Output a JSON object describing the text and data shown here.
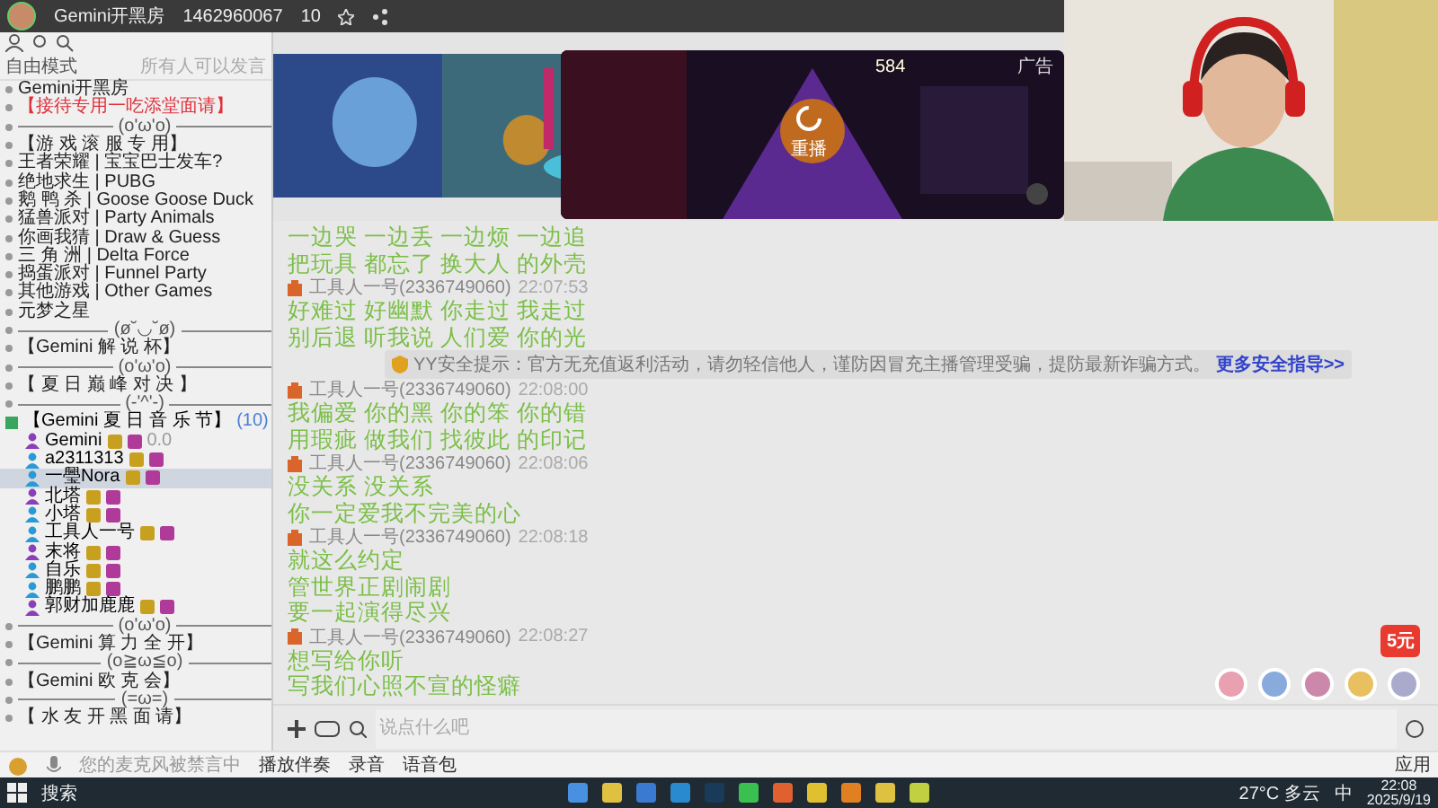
{
  "title_bar": {
    "room_name": "Gemini开黑房",
    "room_id": "1462960067",
    "online": "10"
  },
  "sidebar": {
    "mode": "自由模式",
    "permission": "所有人可以发言",
    "items": [
      {
        "kind": "channel",
        "label": "Gemini开黑房"
      },
      {
        "kind": "channel",
        "label": "【接待专用一吃添堂面请】",
        "color": "#e0303a"
      },
      {
        "kind": "divider",
        "label": "(o'ω'o)"
      },
      {
        "kind": "channel",
        "label": "【游 戏 滚 服 专 用】"
      },
      {
        "kind": "channel",
        "label": "王者荣耀 | 宝宝巴士发车?"
      },
      {
        "kind": "channel",
        "label": "绝地求生 | PUBG"
      },
      {
        "kind": "channel",
        "label": "鹅 鸭 杀 | Goose Goose Duck"
      },
      {
        "kind": "channel",
        "label": "猛兽派对 | Party Animals"
      },
      {
        "kind": "channel",
        "label": "你画我猜 | Draw & Guess"
      },
      {
        "kind": "channel",
        "label": "三 角 洲 | Delta Force"
      },
      {
        "kind": "channel",
        "label": "捣蛋派对 | Funnel Party"
      },
      {
        "kind": "channel",
        "label": "其他游戏 | Other Games"
      },
      {
        "kind": "channel",
        "label": "元梦之星"
      },
      {
        "kind": "divider",
        "label": "(ø˘◡˘ø)"
      },
      {
        "kind": "channel",
        "label": "【Gemini 解 说 杯】"
      },
      {
        "kind": "divider",
        "label": "(o'ω'o)"
      },
      {
        "kind": "channel",
        "label": "【 夏 日 巅 峰 对 决 】"
      },
      {
        "kind": "divider",
        "label": "(-'^'-)"
      },
      {
        "kind": "group",
        "label": "【Gemini 夏 日 音 乐 节】",
        "count": "(10)",
        "users": [
          {
            "name": "Gemini",
            "extra": "0.0",
            "selected": false
          },
          {
            "name": "a2311313",
            "selected": false
          },
          {
            "name": "一璺Nora",
            "selected": true
          },
          {
            "name": "北塔",
            "selected": false
          },
          {
            "name": "小塔",
            "selected": false
          },
          {
            "name": "工具人一号",
            "selected": false
          },
          {
            "name": "末将",
            "selected": false
          },
          {
            "name": "自乐",
            "selected": false
          },
          {
            "name": "鹏鹏",
            "selected": false
          },
          {
            "name": "郭财加鹿鹿",
            "selected": false
          }
        ]
      },
      {
        "kind": "divider",
        "label": "(o'ω'o)"
      },
      {
        "kind": "channel",
        "label": "【Gemini 算 力 全 开】"
      },
      {
        "kind": "divider",
        "label": "(o≧ω≦o)"
      },
      {
        "kind": "channel",
        "label": "【Gemini 欧 克 会】"
      },
      {
        "kind": "divider",
        "label": "(=ω=)"
      },
      {
        "kind": "channel",
        "label": "【 水 友 开 黑 面 请】"
      }
    ]
  },
  "video": {
    "ad_label": "广告",
    "counter": "584",
    "replay": "重播"
  },
  "chat": [
    {
      "kind": "lines",
      "lines": [
        "一边哭 一边丢 一边烦 一边追",
        "把玩具 都忘了 换大人 的外壳"
      ]
    },
    {
      "kind": "message",
      "sender": "工具人一号(2336749060)",
      "time": "22:07:53",
      "lines": [
        "好难过 好幽默 你走过 我走过",
        "别后退 听我说 人们爱 你的光"
      ]
    },
    {
      "kind": "notice",
      "text": "YY安全提示：官方无充值返利活动，请勿轻信他人，谨防因冒充主播管理受骗，提防最新诈骗方式。",
      "link": "更多安全指导>>"
    },
    {
      "kind": "message",
      "sender": "工具人一号(2336749060)",
      "time": "22:08:00",
      "lines": [
        "我偏爱 你的黑 你的笨 你的错",
        "用瑕疵 做我们 找彼此 的印记"
      ]
    },
    {
      "kind": "message",
      "sender": "工具人一号(2336749060)",
      "time": "22:08:06",
      "lines": [
        "没关系 没关系",
        "你一定爱我不完美的心"
      ]
    },
    {
      "kind": "message",
      "sender": "工具人一号(2336749060)",
      "time": "22:08:18",
      "lines": [
        "就这么约定",
        "管世界正剧闹剧",
        "要一起演得尽兴"
      ]
    },
    {
      "kind": "message",
      "sender": "工具人一号(2336749060)",
      "time": "22:08:27",
      "lines": [
        "想写给你听",
        "写我们心照不宣的怪癖"
      ]
    }
  ],
  "promo_badge": "5元",
  "input": {
    "placeholder": "说点什么吧"
  },
  "toolbar": {
    "mic_status": "您的麦克风被禁言中",
    "items": [
      "播放伴奏",
      "录音",
      "语音包"
    ],
    "apps": "应用"
  },
  "taskbar": {
    "search": "搜索",
    "weather": "27°C 多云",
    "ime": "中",
    "time": "22:08",
    "date": "2025/9/19"
  }
}
